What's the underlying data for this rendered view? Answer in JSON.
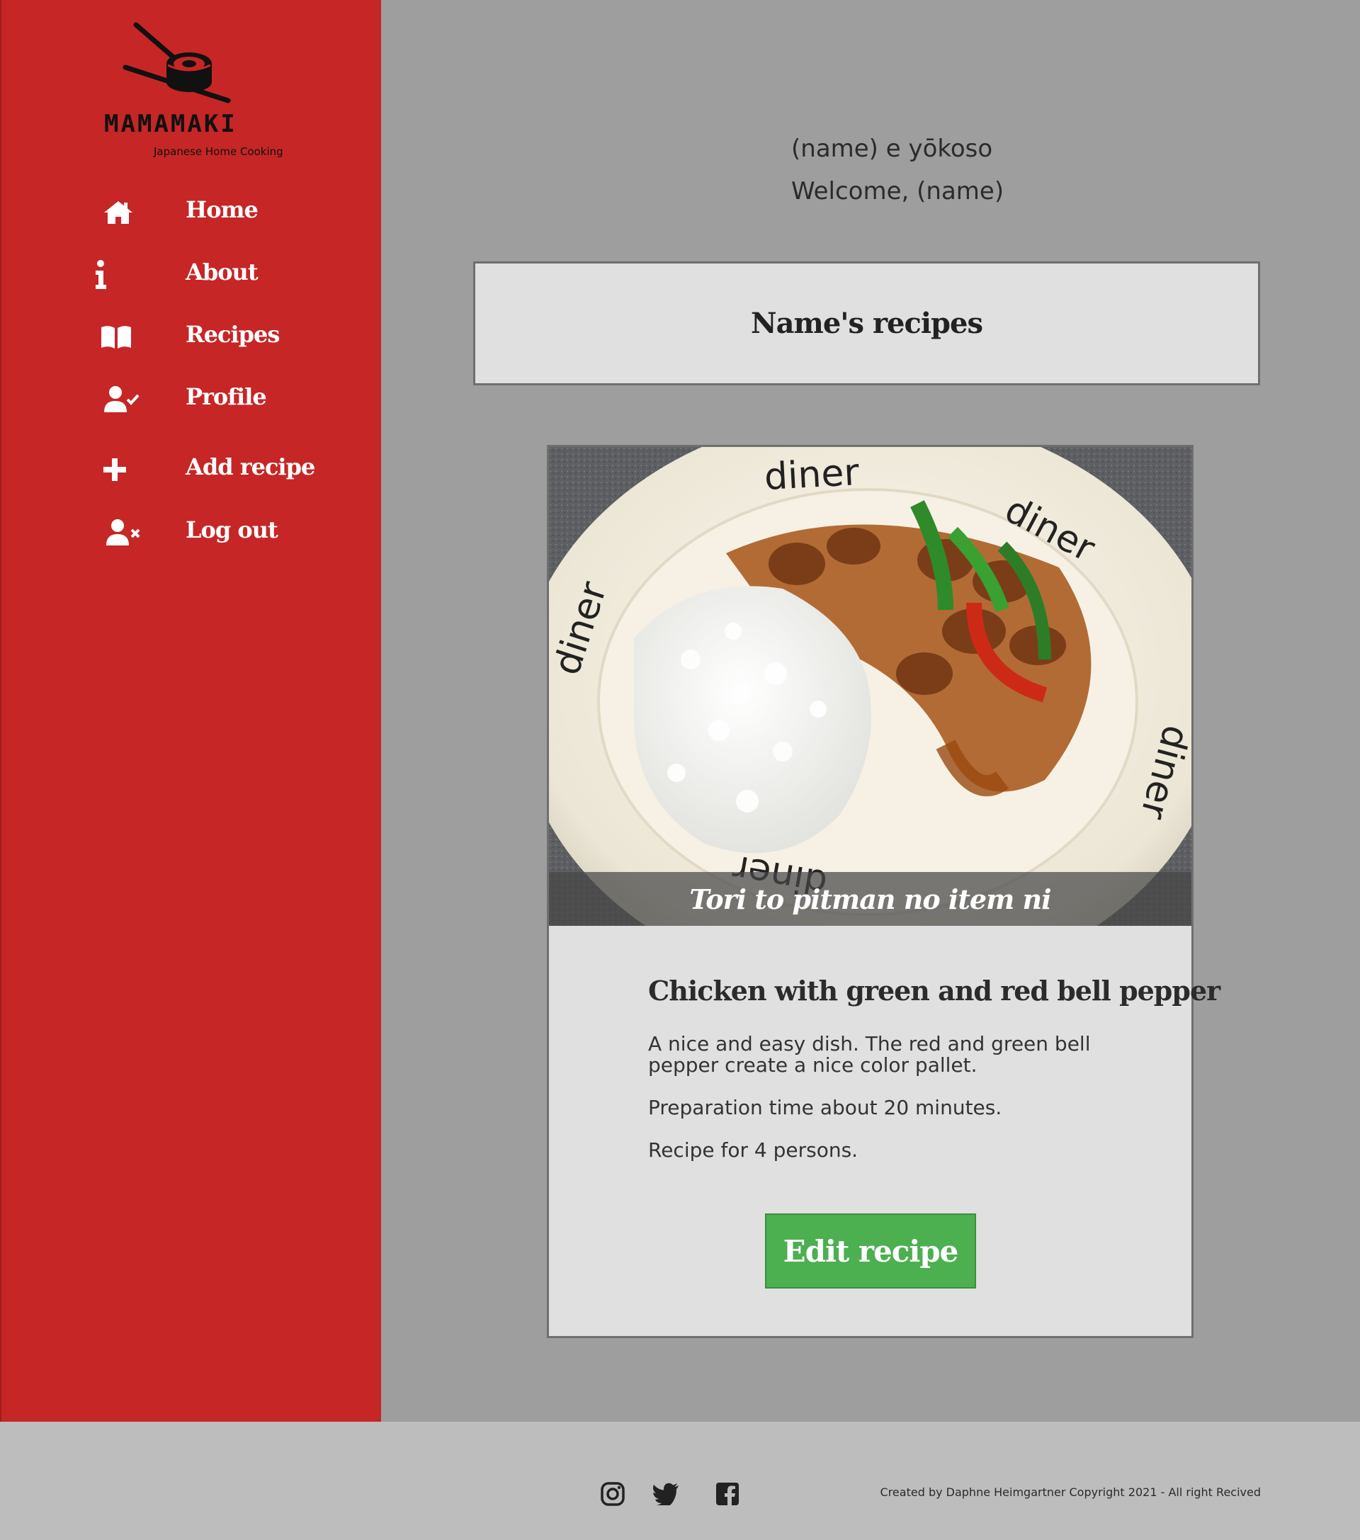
{
  "brand": {
    "name": "MAMAMAKI",
    "tagline": "Japanese Home Cooking"
  },
  "nav": {
    "items": [
      {
        "label": "Home",
        "icon": "home-icon"
      },
      {
        "label": "About",
        "icon": "info-icon"
      },
      {
        "label": "Recipes",
        "icon": "book-icon"
      },
      {
        "label": "Profile",
        "icon": "user-check-icon"
      },
      {
        "label": "Add recipe",
        "icon": "plus-icon"
      },
      {
        "label": "Log out",
        "icon": "user-x-icon"
      }
    ]
  },
  "greeting": {
    "japanese": "(name) e yōkoso",
    "english": "Welcome, (name)"
  },
  "recipes_header": {
    "title": "Name's recipes"
  },
  "recipe_card": {
    "image_caption": "Tori to pitman no item ni",
    "title": "Chicken with green and red bell pepper",
    "description": "A nice and easy dish. The red and green bell pepper create a nice color pallet.",
    "prep_time": "Preparation time about 20 minutes.",
    "servings": "Recipe for 4 persons.",
    "edit_label": "Edit recipe",
    "plate_text": "diner"
  },
  "footer": {
    "social": [
      "instagram-icon",
      "twitter-icon",
      "facebook-icon"
    ],
    "copyright": "Created by Daphne Heimgartner Copyright 2021 - All right Recived"
  },
  "colors": {
    "sidebar": "#c62626",
    "main_bg": "#9e9e9e",
    "panel": "#e0e0e0",
    "button": "#4caf50",
    "footer": "#bdbdbd"
  }
}
